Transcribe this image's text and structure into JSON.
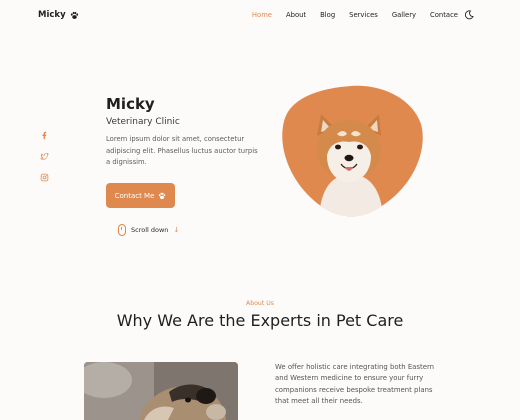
{
  "nav": {
    "brand": "Micky",
    "items": [
      "Home",
      "About",
      "Blog",
      "Services",
      "Gallery",
      "Contace"
    ],
    "active_index": 0
  },
  "social": [
    "facebook-icon",
    "twitter-icon",
    "instagram-icon"
  ],
  "hero": {
    "name": "Micky",
    "subtitle": "Veterinary Clinic",
    "description": "Lorem ipsum dolor sit amet, consectetur adipiscing elit. Phasellus luctus auctor turpis a dignissim.",
    "cta_label": "Contact Me",
    "scroll_label": "Scroll down"
  },
  "about": {
    "eyebrow": "About Us",
    "title": "Why We Are the Experts in Pet Care",
    "text": "We offer holistic care integrating both Eastern and Western medicine to ensure your furry companions receive bespoke treatment plans that meet all their needs."
  },
  "colors": {
    "accent": "#e0894f",
    "background": "#fcfbfa"
  }
}
